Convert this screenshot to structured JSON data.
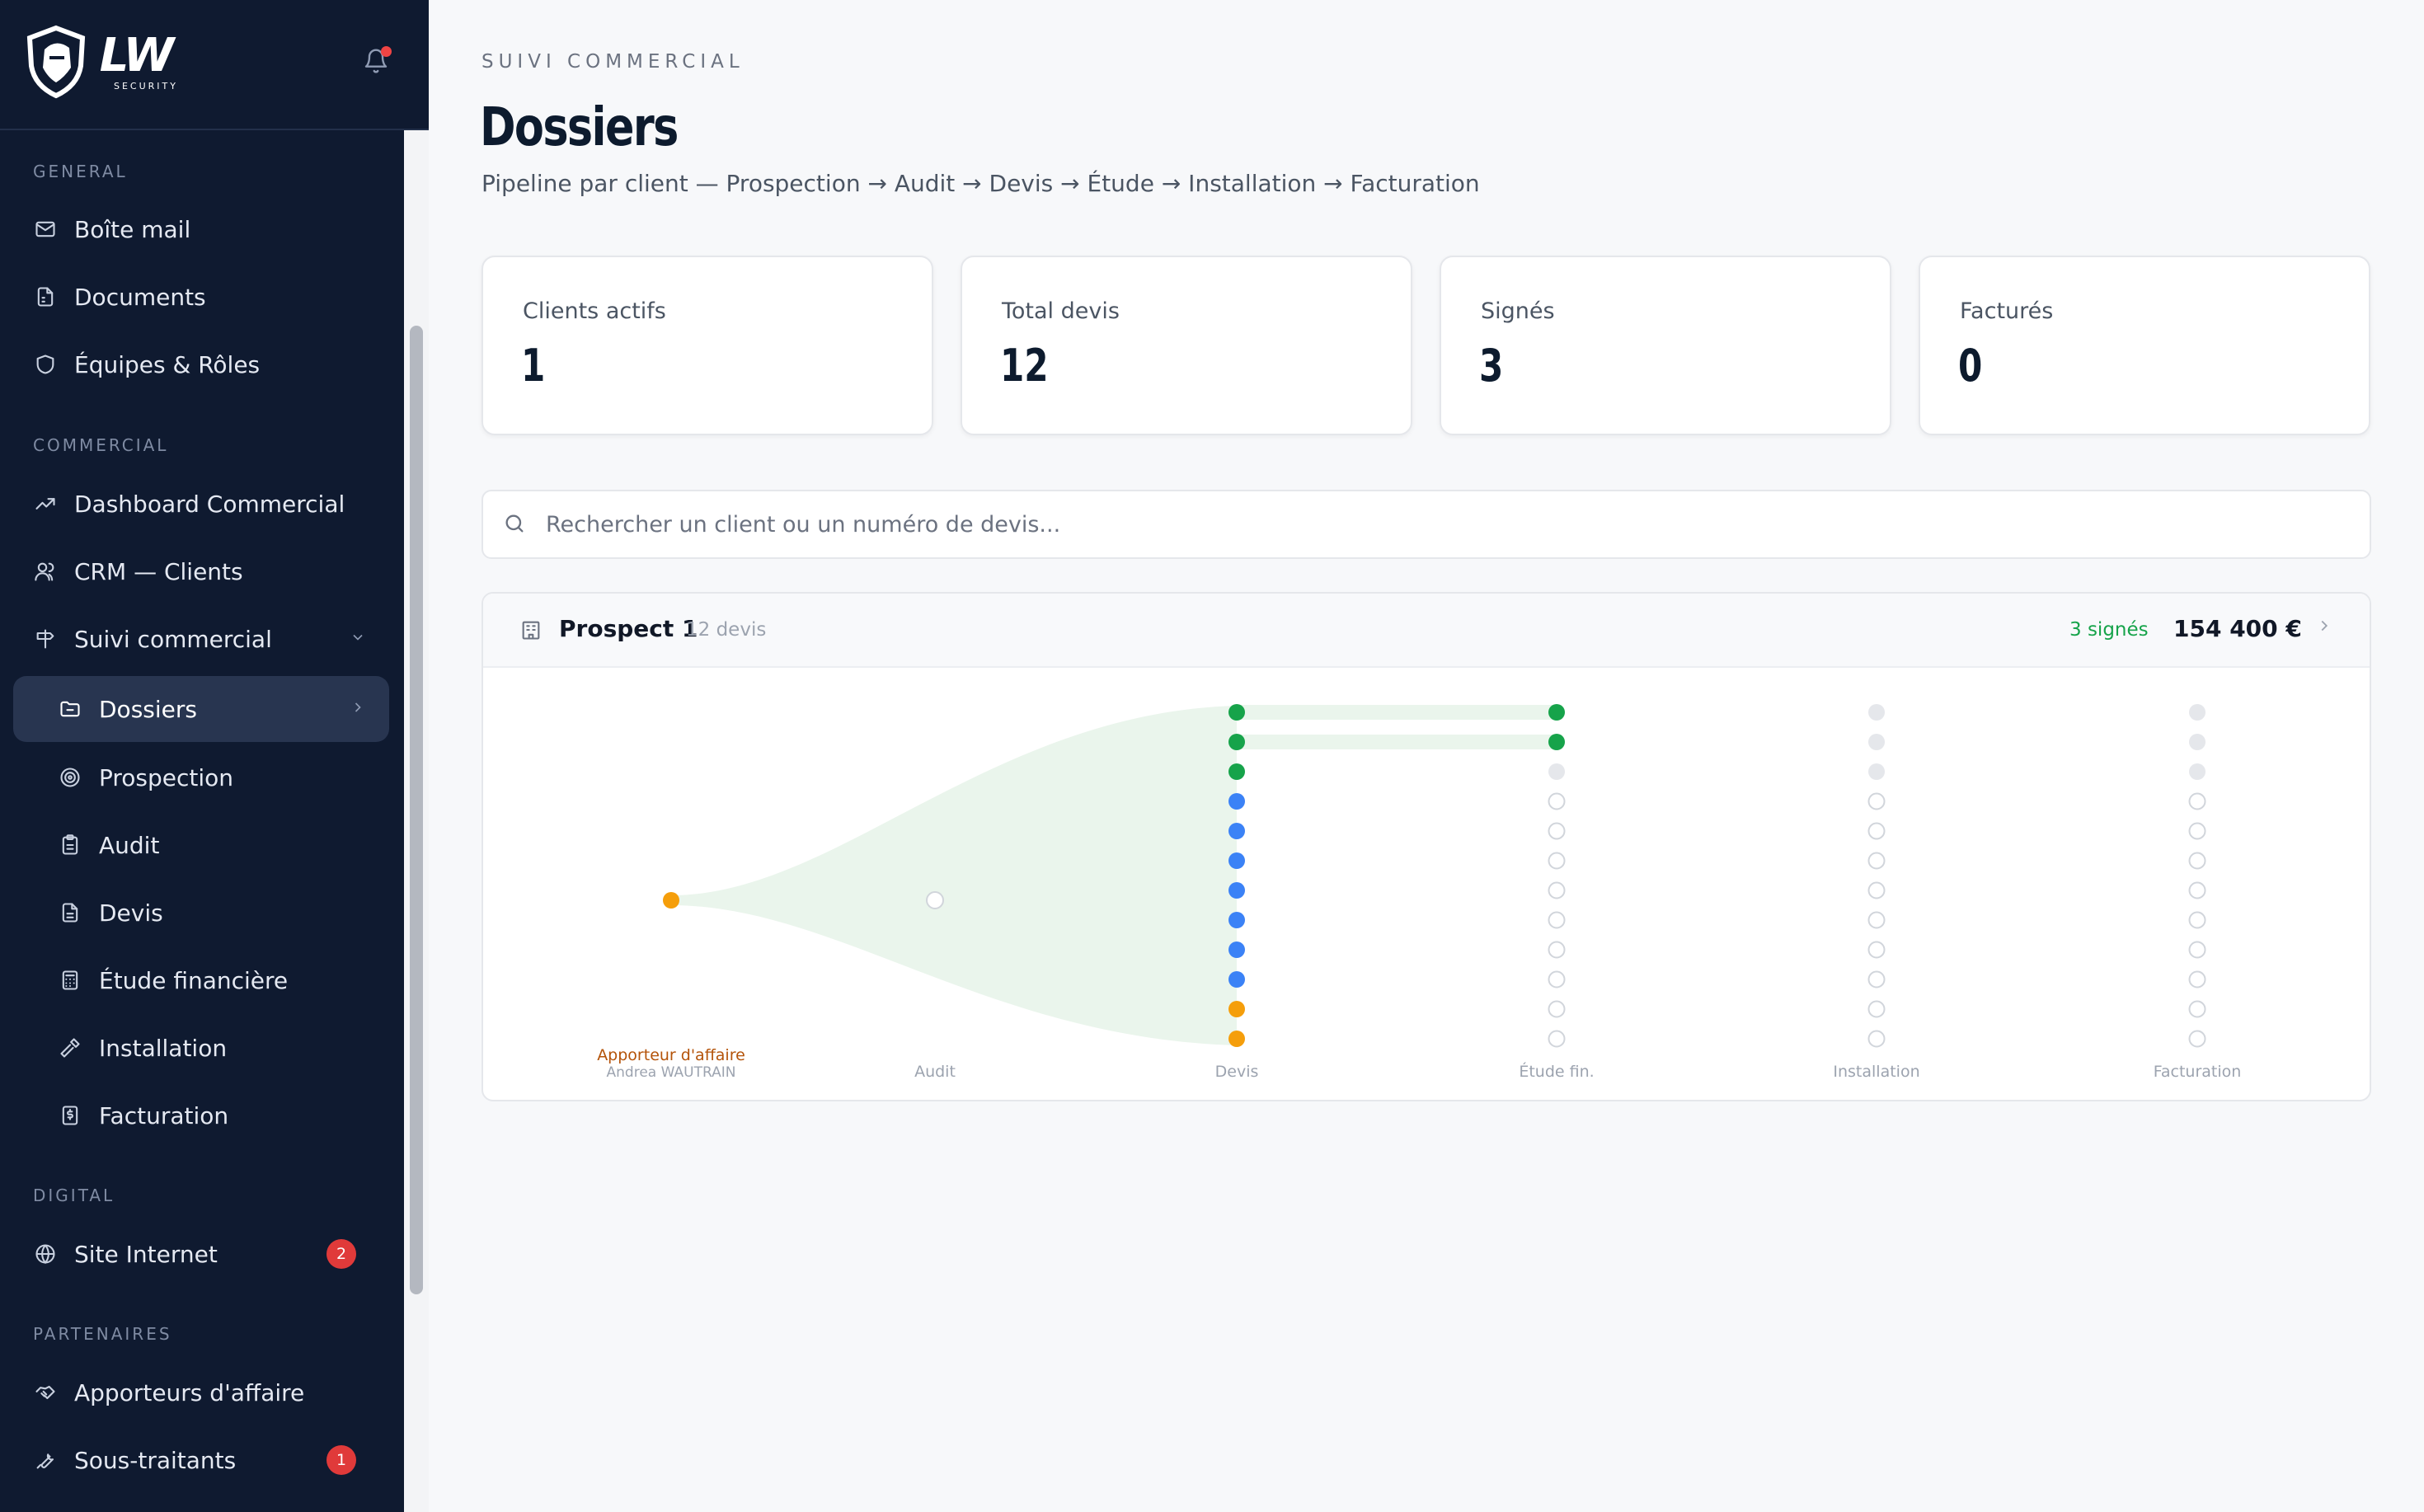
{
  "sidebar": {
    "logo": "LW",
    "logo_sub": "SECURITY",
    "sections": {
      "general": "GENERAL",
      "commercial": "COMMERCIAL",
      "digital": "DIGITAL",
      "partenaires": "PARTENAIRES"
    },
    "items": {
      "mail": "Boîte mail",
      "documents": "Documents",
      "equipes": "Équipes & Rôles",
      "dashboard": "Dashboard Commercial",
      "crm": "CRM — Clients",
      "suivi": "Suivi commercial",
      "dossiers": "Dossiers",
      "prospection": "Prospection",
      "audit": "Audit",
      "devis": "Devis",
      "etude": "Étude financière",
      "installation": "Installation",
      "facturation": "Facturation",
      "site": "Site Internet",
      "apporteurs": "Apporteurs d'affaire",
      "sous_traitants": "Sous-traitants"
    },
    "badges": {
      "site": "2",
      "sous_traitants": "1"
    }
  },
  "header": {
    "eyebrow": "SUIVI COMMERCIAL",
    "title": "Dossiers",
    "subtitle": "Pipeline par client — Prospection → Audit → Devis → Étude → Installation → Facturation"
  },
  "stats": [
    {
      "label": "Clients actifs",
      "value": "1"
    },
    {
      "label": "Total devis",
      "value": "12"
    },
    {
      "label": "Signés",
      "value": "3"
    },
    {
      "label": "Facturés",
      "value": "0"
    }
  ],
  "search": {
    "placeholder": "Rechercher un client ou un numéro de devis..."
  },
  "pipeline": {
    "client": "Prospect 1",
    "count": "12 devis",
    "signed": "3 signés",
    "amount": "154 400 €",
    "source_label": "Apporteur d'affaire",
    "source_name": "Andrea WAUTRAIN",
    "stages": [
      "Audit",
      "Devis",
      "Étude fin.",
      "Installation",
      "Facturation"
    ],
    "devis_status": [
      "signed",
      "signed",
      "signed",
      "sent",
      "sent",
      "sent",
      "sent",
      "sent",
      "sent",
      "sent",
      "pending",
      "pending"
    ],
    "etude_status": [
      "done",
      "done",
      "todo",
      "empty",
      "empty",
      "empty",
      "empty",
      "empty",
      "empty",
      "empty",
      "empty",
      "empty"
    ],
    "install_status": [
      "todo",
      "todo",
      "todo",
      "empty",
      "empty",
      "empty",
      "empty",
      "empty",
      "empty",
      "empty",
      "empty",
      "empty"
    ],
    "factu_status": [
      "todo",
      "todo",
      "todo",
      "empty",
      "empty",
      "empty",
      "empty",
      "empty",
      "empty",
      "empty",
      "empty",
      "empty"
    ],
    "colors": {
      "signed": "#16a34a",
      "sent": "#3b82f6",
      "pending": "#f59e0b",
      "todo": "#e5e7eb",
      "flow": "#eaf5ec"
    }
  }
}
